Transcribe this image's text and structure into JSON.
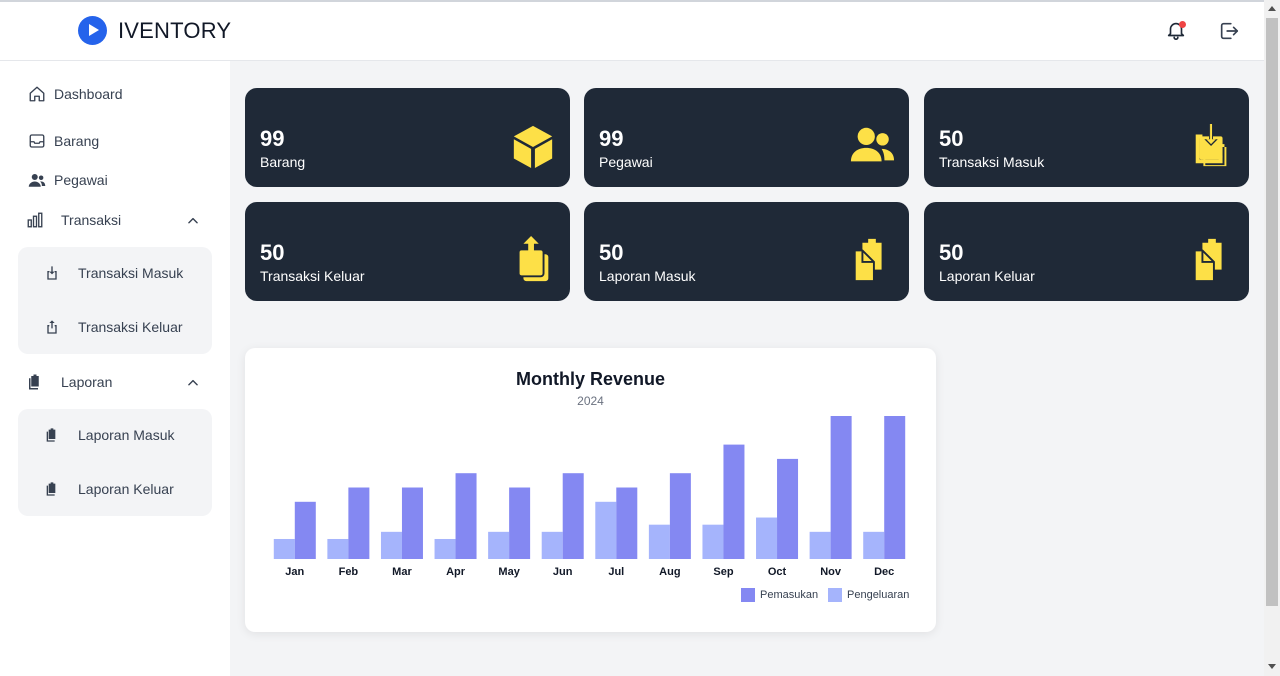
{
  "header": {
    "brand": "IVENTORY"
  },
  "sidebar": {
    "dashboard": "Dashboard",
    "barang": "Barang",
    "pegawai": "Pegawai",
    "transaksi": "Transaksi",
    "transaksi_masuk": "Transaksi Masuk",
    "transaksi_keluar": "Transaksi Keluar",
    "laporan": "Laporan",
    "laporan_masuk": "Laporan Masuk",
    "laporan_keluar": "Laporan Keluar"
  },
  "cards": [
    {
      "value": "99",
      "label": "Barang",
      "icon": "cube-icon"
    },
    {
      "value": "99",
      "label": "Pegawai",
      "icon": "users-icon"
    },
    {
      "value": "50",
      "label": "Transaksi Masuk",
      "icon": "inbox-in-icon"
    },
    {
      "value": "50",
      "label": "Transaksi Keluar",
      "icon": "inbox-out-icon"
    },
    {
      "value": "50",
      "label": "Laporan Masuk",
      "icon": "clipboard-icon"
    },
    {
      "value": "50",
      "label": "Laporan Keluar",
      "icon": "clipboard-icon"
    }
  ],
  "colors": {
    "card_bg": "#1f2937",
    "icon_yellow": "#fde047",
    "pemasukan": "#8488f2",
    "pengeluaran": "#a5b4fc"
  },
  "chart_data": {
    "type": "bar",
    "title": "Monthly Revenue",
    "subtitle": "2024",
    "categories": [
      "Jan",
      "Feb",
      "Mar",
      "Apr",
      "May",
      "Jun",
      "Jul",
      "Aug",
      "Sep",
      "Oct",
      "Nov",
      "Dec"
    ],
    "series": [
      {
        "name": "Pemasukan",
        "color": "#8488f2",
        "values": [
          4,
          5,
          5,
          6,
          5,
          6,
          5,
          6,
          8,
          7,
          10,
          10
        ]
      },
      {
        "name": "Pengeluaran",
        "color": "#a5b4fc",
        "values": [
          1.4,
          1.4,
          1.9,
          1.4,
          1.9,
          1.9,
          4,
          2.4,
          2.4,
          2.9,
          1.9,
          1.9
        ]
      }
    ],
    "ylim": [
      0,
      10
    ],
    "grid": false,
    "legend": "bottom-right"
  }
}
